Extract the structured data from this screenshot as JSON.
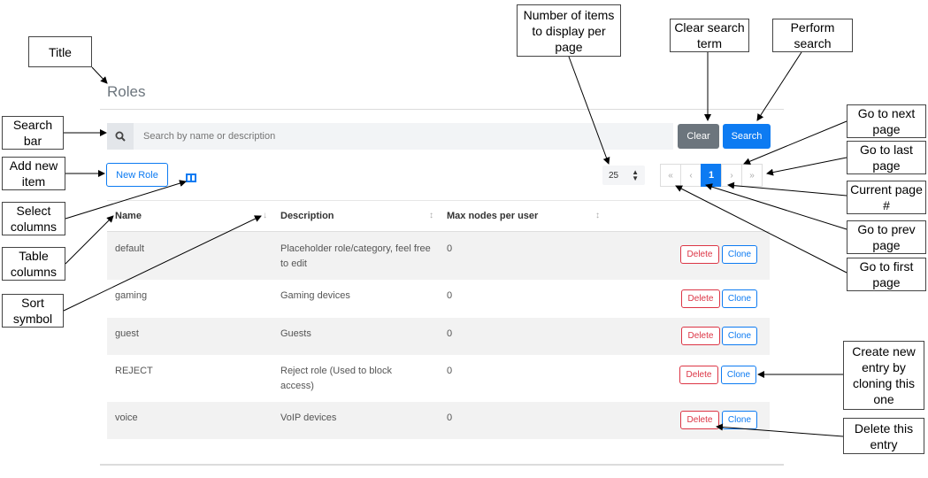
{
  "page": {
    "title": "Roles"
  },
  "search": {
    "placeholder": "Search by name or description",
    "clear_label": "Clear",
    "search_label": "Search"
  },
  "toolbar": {
    "new_label": "New Role",
    "per_page": "25"
  },
  "pagination": {
    "first": "«",
    "prev": "‹",
    "current": "1",
    "next": "›",
    "last": "»"
  },
  "table": {
    "columns": [
      "Name",
      "Description",
      "Max nodes per user"
    ],
    "sort_symbols": [
      "↓",
      "↕",
      "↕"
    ],
    "delete_label": "Delete",
    "clone_label": "Clone",
    "rows": [
      {
        "name": "default",
        "description": "Placeholder role/category, feel free to edit",
        "max_nodes": "0"
      },
      {
        "name": "gaming",
        "description": "Gaming devices",
        "max_nodes": "0"
      },
      {
        "name": "guest",
        "description": "Guests",
        "max_nodes": "0"
      },
      {
        "name": "REJECT",
        "description": "Reject role (Used to block access)",
        "max_nodes": "0"
      },
      {
        "name": "voice",
        "description": "VoIP devices",
        "max_nodes": "0"
      }
    ]
  },
  "annotations": {
    "title": "Title",
    "search_bar": "Search bar",
    "add_new": "Add new item",
    "select_columns": "Select columns",
    "table_columns": "Table columns",
    "sort_symbol": "Sort symbol",
    "items_per_page": "Number of items to display per page",
    "clear_search": "Clear search term",
    "perform_search": "Perform search",
    "next_page": "Go to next page",
    "last_page": "Go to last page",
    "current_page": "Current page #",
    "prev_page": "Go to prev page",
    "first_page": "Go to first page",
    "clone_entry": "Create new entry by cloning this one",
    "delete_entry": "Delete this entry"
  },
  "colors": {
    "primary": "#0d7bf2",
    "secondary": "#6c757d",
    "danger": "#dc3545"
  }
}
